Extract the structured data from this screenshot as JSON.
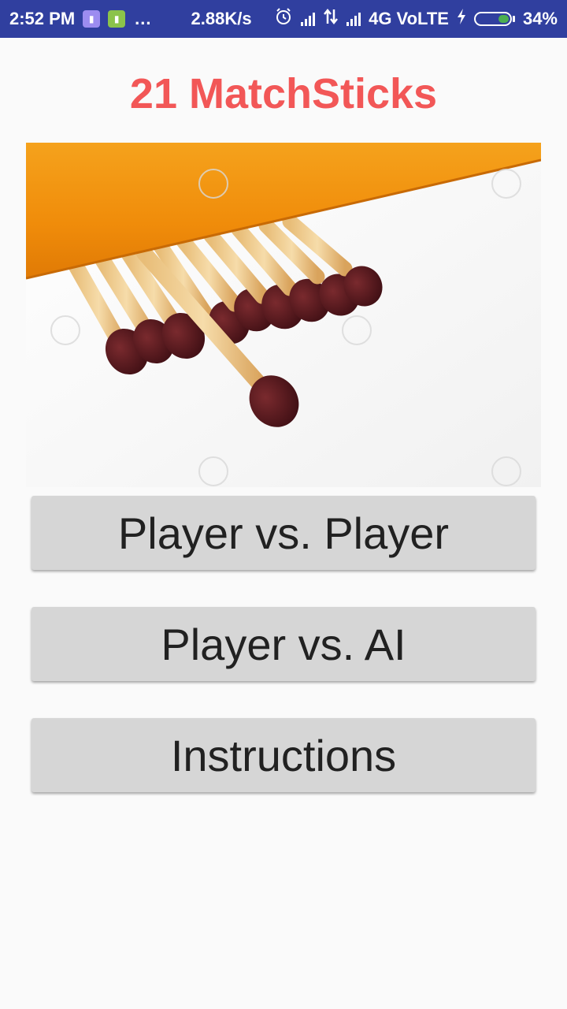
{
  "status_bar": {
    "time": "2:52 PM",
    "more": "...",
    "net_speed": "2.88K/s",
    "network": "4G VoLTE",
    "battery_percent": "34%",
    "battery_level": 0.34,
    "icons": [
      "app-notification-icon",
      "battery-saver-icon",
      "alarm-icon",
      "signal-icon",
      "data-transfer-icon",
      "signal-icon",
      "charging-icon",
      "battery-icon"
    ]
  },
  "app": {
    "title": "21 MatchSticks",
    "title_color": "#f25757"
  },
  "hero_image": {
    "description_icon": "matchsticks-image"
  },
  "buttons": {
    "pvp": "Player vs. Player",
    "pvai": "Player vs. AI",
    "instructions": "Instructions"
  },
  "colors": {
    "status_bar": "#303f9f",
    "button_bg": "#d6d6d6",
    "background": "#fafafa"
  }
}
